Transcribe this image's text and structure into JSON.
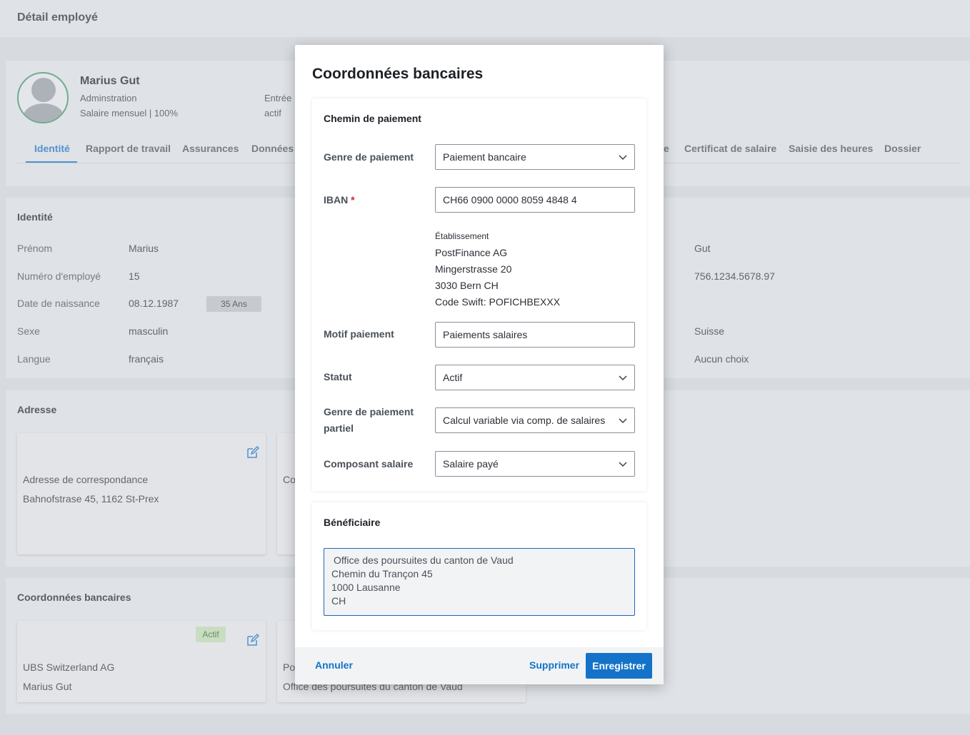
{
  "page": {
    "title": "Détail employé"
  },
  "employee": {
    "name": "Marius Gut",
    "department": "Adminstration",
    "salary": "Salaire mensuel | 100%",
    "entry_label": "Entrée",
    "status": "actif"
  },
  "tabs": [
    {
      "label": "Identité",
      "active": true
    },
    {
      "label": "Rapport de travail"
    },
    {
      "label": "Assurances"
    },
    {
      "label": "Données s"
    },
    {
      "label": "e"
    },
    {
      "label": "Certificat de salaire"
    },
    {
      "label": "Saisie des heures"
    },
    {
      "label": "Dossier"
    }
  ],
  "identity": {
    "heading": "Identité",
    "rows": [
      {
        "label": "Prénom",
        "value": "Marius",
        "right": "Gut"
      },
      {
        "label": "Numéro d'employé",
        "value": "15",
        "right": "756.1234.5678.97"
      },
      {
        "label": "Date de naissance",
        "value": "08.12.1987",
        "badge": "35 Ans"
      },
      {
        "label": "Sexe",
        "value": "masculin",
        "right": "Suisse"
      },
      {
        "label": "Langue",
        "value": "français",
        "right": "Aucun choix"
      }
    ]
  },
  "address": {
    "heading": "Adresse",
    "card1": {
      "title": "Adresse de correspondance",
      "line": "Bahnofstrase 45, 1162 St-Prex"
    },
    "card2": {
      "title": "Co"
    }
  },
  "bank": {
    "heading": "Coordonnées bancaires",
    "card1": {
      "badge": "Actif",
      "bank": "UBS Switzerland AG",
      "holder": "Marius Gut"
    },
    "card2": {
      "bank": "Po",
      "holder": "Office des poursuites du canton de Vaud"
    }
  },
  "modal": {
    "title": "Coordonnées bancaires",
    "payment_section": {
      "heading": "Chemin de paiement",
      "genre_label": "Genre de paiement",
      "genre_value": "Paiement bancaire",
      "iban_label": "IBAN",
      "iban_required": "*",
      "iban_value": "CH66 0900 0000 8059 4848 4",
      "institution_caption": "Établissement",
      "institution_name": "PostFinance AG",
      "institution_street": "Mingerstrasse 20",
      "institution_city": "3030 Bern CH",
      "institution_swift": "Code Swift: POFICHBEXXX",
      "motif_label": "Motif paiement",
      "motif_value": "Paiements salaires",
      "statut_label": "Statut",
      "statut_value": "Actif",
      "partiel_label_1": "Genre de paiement",
      "partiel_label_2": "partiel",
      "partiel_value": "Calcul variable via comp. de salaires",
      "composant_label": "Composant salaire",
      "composant_value": "Salaire payé"
    },
    "beneficiary": {
      "heading": "Bénéficiaire",
      "line1": "Office des poursuites du canton de Vaud",
      "line2": "Chemin du Trançon 45",
      "line3": "1000 Lausanne",
      "line4": "CH"
    },
    "footer": {
      "cancel": "Annuler",
      "delete": "Supprimer",
      "save": "Enregistrer"
    }
  },
  "colors": {
    "primary": "#1473c9",
    "active_badge_bg": "#c9e6b9",
    "avatar_ring": "#3f9d6a"
  }
}
